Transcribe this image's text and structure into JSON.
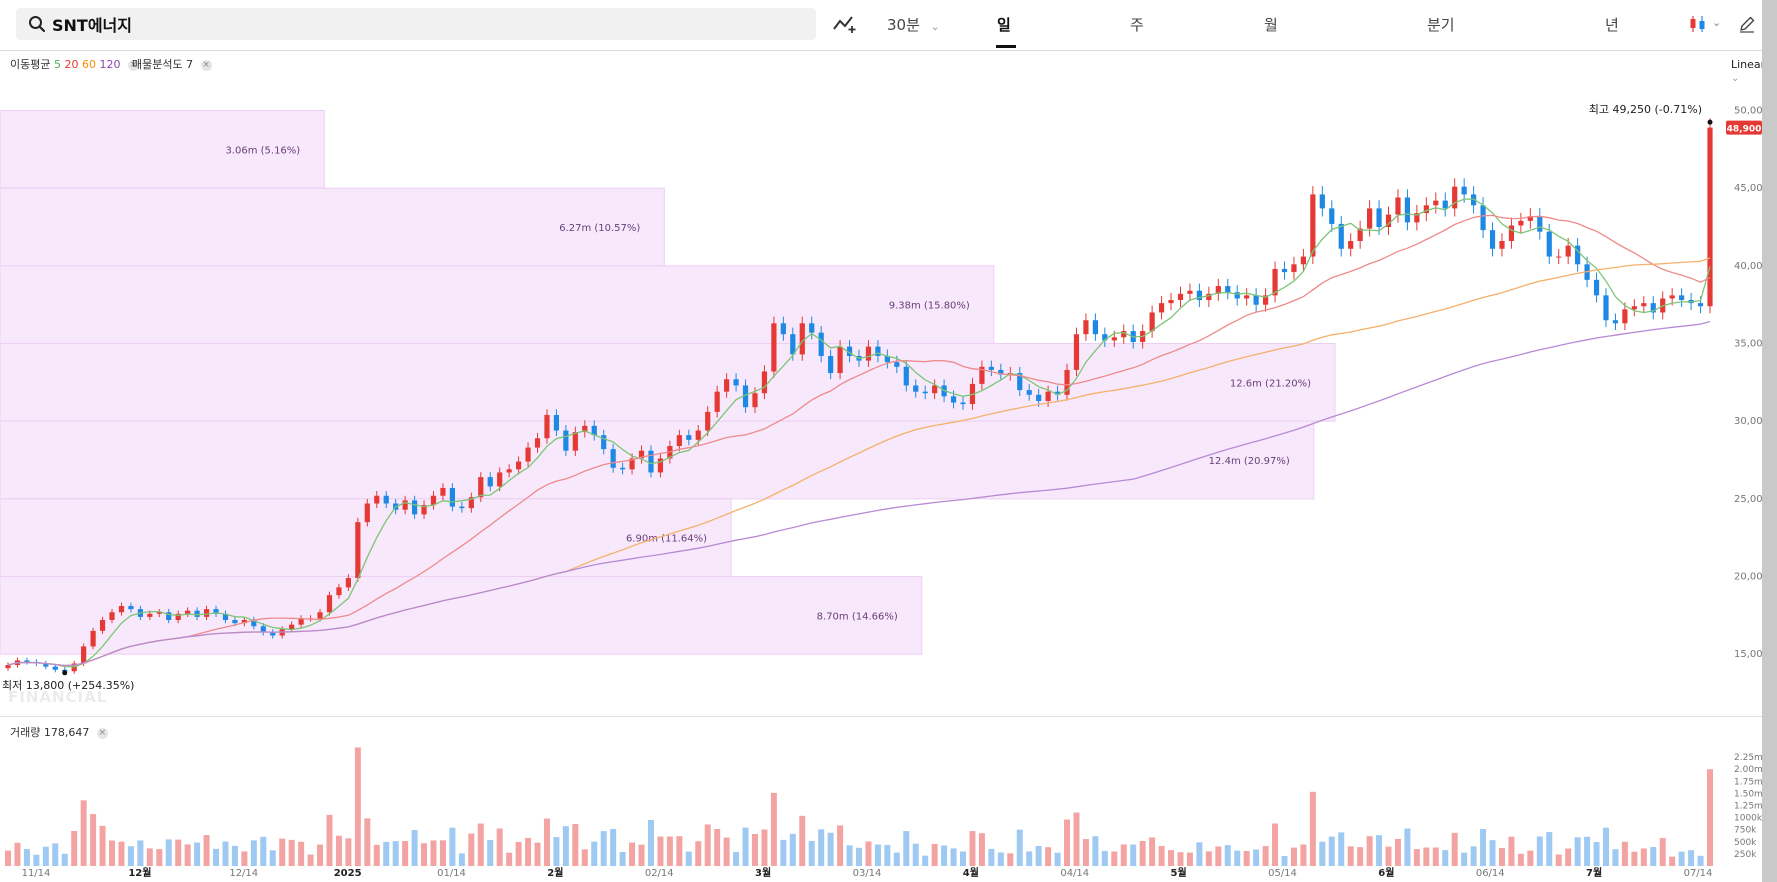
{
  "toolbar": {
    "search_value": "SNT에너지",
    "intervals": [
      {
        "label": "30분",
        "chevron": "⌄"
      },
      {
        "label": "일"
      },
      {
        "label": "주"
      },
      {
        "label": "월"
      },
      {
        "label": "분기"
      },
      {
        "label": "년"
      }
    ],
    "active_interval": "일",
    "icons": [
      "search-icon",
      "chart-type-icon",
      "candlestick-icon",
      "chevron-down-icon",
      "pencil-icon"
    ]
  },
  "indicators": {
    "ma_label": "이동평균",
    "ma_periods": [
      {
        "value": "5",
        "color": "#4caf50"
      },
      {
        "value": "20",
        "color": "#e53935"
      },
      {
        "value": "60",
        "color": "#fb8c00"
      },
      {
        "value": "120",
        "color": "#8e44ad"
      }
    ],
    "vp_label": "매물분석도 7",
    "volume_label": "거래량 178,647",
    "scale_mode": "Linear",
    "watermark": "FINANCIAL"
  },
  "chart_data": {
    "type": "candlestick",
    "y_axis_ticks": [
      "50,000",
      "45,000",
      "40,000",
      "35,000",
      "30,000",
      "25,000",
      "20,000",
      "15,000"
    ],
    "volume_axis_ticks": [
      "2.25m",
      "2.00m",
      "1.75m",
      "1.50m",
      "1.25m",
      "1000k",
      "750k",
      "500k",
      "250k"
    ],
    "x_axis_labels": [
      "11/14",
      "12월",
      "12/14",
      "2025",
      "01/14",
      "2월",
      "02/14",
      "3월",
      "03/14",
      "4월",
      "04/14",
      "5월",
      "05/14",
      "6월",
      "06/14",
      "7월",
      "07/14"
    ],
    "ylim": [
      12500,
      51000
    ],
    "current_price": "48,900",
    "high_marker": {
      "label": "최고",
      "value": "49,250 (-0.71%)"
    },
    "low_marker": {
      "label": "최저",
      "value": "13,800 (+254.35%)"
    },
    "volume_profile": [
      {
        "label": "3.06m (5.16%)",
        "price_low": 45000,
        "price_high": 50000,
        "volume_m": 3.06
      },
      {
        "label": "6.27m (10.57%)",
        "price_low": 40000,
        "price_high": 45000,
        "volume_m": 6.27
      },
      {
        "label": "9.38m (15.80%)",
        "price_low": 35000,
        "price_high": 40000,
        "volume_m": 9.38
      },
      {
        "label": "12.6m (21.20%)",
        "price_low": 30000,
        "price_high": 35000,
        "volume_m": 12.6
      },
      {
        "label": "12.4m (20.97%)",
        "price_low": 25000,
        "price_high": 30000,
        "volume_m": 12.4
      },
      {
        "label": "6.90m (11.64%)",
        "price_low": 20000,
        "price_high": 25000,
        "volume_m": 6.9
      },
      {
        "label": "8.70m (14.66%)",
        "price_low": 15000,
        "price_high": 20000,
        "volume_m": 8.7
      }
    ],
    "series": [
      {
        "name": "close",
        "values": [
          14300,
          14600,
          14500,
          14400,
          14200,
          14000,
          13900,
          14400,
          15500,
          16500,
          17200,
          17700,
          18100,
          17900,
          17400,
          17600,
          17700,
          17200,
          17600,
          17800,
          17400,
          17900,
          17600,
          17200,
          17000,
          17200,
          16800,
          16400,
          16200,
          16600,
          16900,
          17300,
          17300,
          17700,
          18800,
          19300,
          19900,
          23500,
          24700,
          25200,
          24700,
          24300,
          24900,
          24000,
          24600,
          25200,
          25700,
          24500,
          24400,
          25100,
          26400,
          25800,
          26700,
          26900,
          27400,
          28300,
          28900,
          30400,
          29400,
          28100,
          29300,
          29700,
          29100,
          28200,
          27000,
          26900,
          27600,
          28100,
          26700,
          27600,
          28400,
          29100,
          28800,
          29400,
          30600,
          31900,
          32700,
          32300,
          30900,
          31800,
          33200,
          36300,
          35600,
          34300,
          36300,
          35700,
          34200,
          33100,
          34800,
          34200,
          33900,
          34800,
          34200,
          33800,
          33500,
          32300,
          31900,
          31800,
          32300,
          31600,
          31200,
          31100,
          32400,
          33500,
          33300,
          33000,
          33100,
          32000,
          31700,
          31300,
          31900,
          31700,
          33300,
          35600,
          36500,
          35600,
          35200,
          35400,
          35800,
          35100,
          35800,
          37000,
          37600,
          37800,
          38200,
          38400,
          37800,
          38200,
          38700,
          38300,
          37900,
          38100,
          37500,
          38100,
          39800,
          39600,
          40100,
          40600,
          44600,
          43700,
          42700,
          41100,
          41600,
          42400,
          43700,
          42500,
          43300,
          44400,
          42800,
          43400,
          43900,
          44200,
          43700,
          45100,
          44600,
          43900,
          42300,
          41100,
          41600,
          42600,
          42900,
          43200,
          42200,
          40600,
          40600,
          41300,
          40100,
          39100,
          38100,
          36500,
          36300,
          37200,
          37400,
          37600,
          37000,
          37900,
          38100,
          37800,
          37600,
          37400,
          48900
        ],
        "name_shown": false
      }
    ]
  }
}
